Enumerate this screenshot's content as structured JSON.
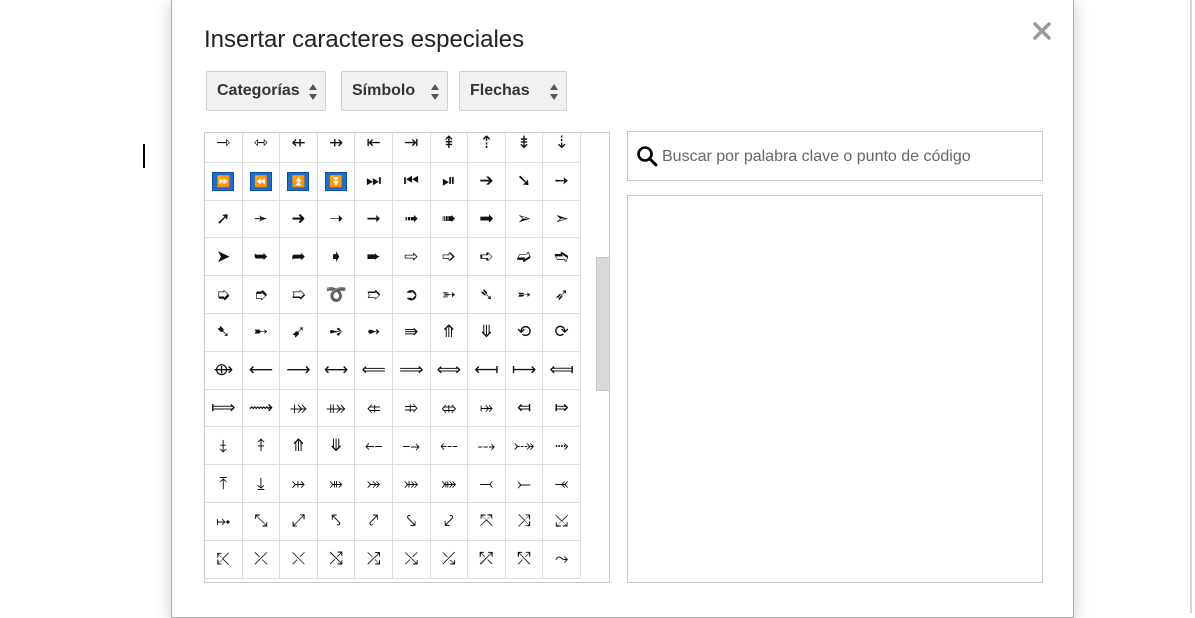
{
  "dialog": {
    "title": "Insertar caracteres especiales",
    "close_label": "×"
  },
  "dropdowns": [
    {
      "label": "Categorías"
    },
    {
      "label": "Símbolo"
    },
    {
      "label": "Flechas"
    }
  ],
  "search": {
    "placeholder": "Buscar por palabra clave o punto de código",
    "value": ""
  },
  "colors": {
    "selected_symbol_bg": "#1a6fd1"
  },
  "icons": {
    "search": "magnifier-icon",
    "close": "close-icon",
    "dropdown": "up-down-arrows-icon"
  },
  "grid": {
    "rows": [
      [
        "⇾",
        "⇿",
        "⇷",
        "⇸",
        "⇤",
        "⇥",
        "⇞",
        "⇡",
        "⇟",
        "⇣"
      ],
      [
        "⏩",
        "⏪",
        "⏫",
        "⏬",
        "⏭",
        "⏮",
        "⏯",
        "➔",
        "➘",
        "➙"
      ],
      [
        "➚",
        "➛",
        "➜",
        "➝",
        "➞",
        "➟",
        "➠",
        "➡",
        "➢",
        "➣"
      ],
      [
        "➤",
        "➥",
        "➦",
        "➧",
        "➨",
        "⇨",
        "➩",
        "➪",
        "➫",
        "➬"
      ],
      [
        "➭",
        "➮",
        "➯",
        "➰",
        "➱",
        "➲",
        "➳",
        "➴",
        "➵",
        "➶"
      ],
      [
        "➷",
        "➸",
        "➹",
        "➺",
        "➻",
        "⇛",
        "⤊",
        "⤋",
        "⟲",
        "⟳"
      ],
      [
        "⟴",
        "⟵",
        "⟶",
        "⟷",
        "⟸",
        "⟹",
        "⟺",
        "⟻",
        "⟼",
        "⟽"
      ],
      [
        "⟾",
        "⟿",
        "⤀",
        "⤁",
        "⤂",
        "⤃",
        "⤄",
        "⤅",
        "⤆",
        "⤇"
      ],
      [
        "⤈",
        "⤉",
        "⤊",
        "⤋",
        "⤌",
        "⤍",
        "⤎",
        "⤏",
        "⤐",
        "⤑"
      ],
      [
        "⤒",
        "⤓",
        "⤔",
        "⤕",
        "⤖",
        "⤗",
        "⤘",
        "⤙",
        "⤚",
        "⤛"
      ],
      [
        "⤠",
        "⤡",
        "⤢",
        "⤣",
        "⤤",
        "⤥",
        "⤦",
        "⤧",
        "⤨",
        "⤩"
      ],
      [
        "⤪",
        "⤫",
        "⤬",
        "⤭",
        "⤮",
        "⤯",
        "⤰",
        "⤱",
        "⤲",
        "⤳"
      ]
    ],
    "boxed": [
      [
        1,
        0
      ],
      [
        1,
        1
      ],
      [
        1,
        2
      ],
      [
        1,
        3
      ]
    ]
  }
}
